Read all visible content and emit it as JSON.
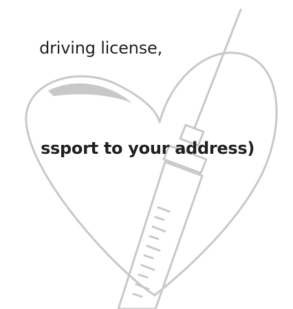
{
  "text": {
    "line_1": "driving license,",
    "line_2": "ssport to your address)"
  },
  "colors": {
    "text": "#1f1f1f",
    "illustration_stroke": "#c8c8c8",
    "background": "#ffffff"
  },
  "icons": {
    "illustration": "heart-with-syringe-icon"
  }
}
